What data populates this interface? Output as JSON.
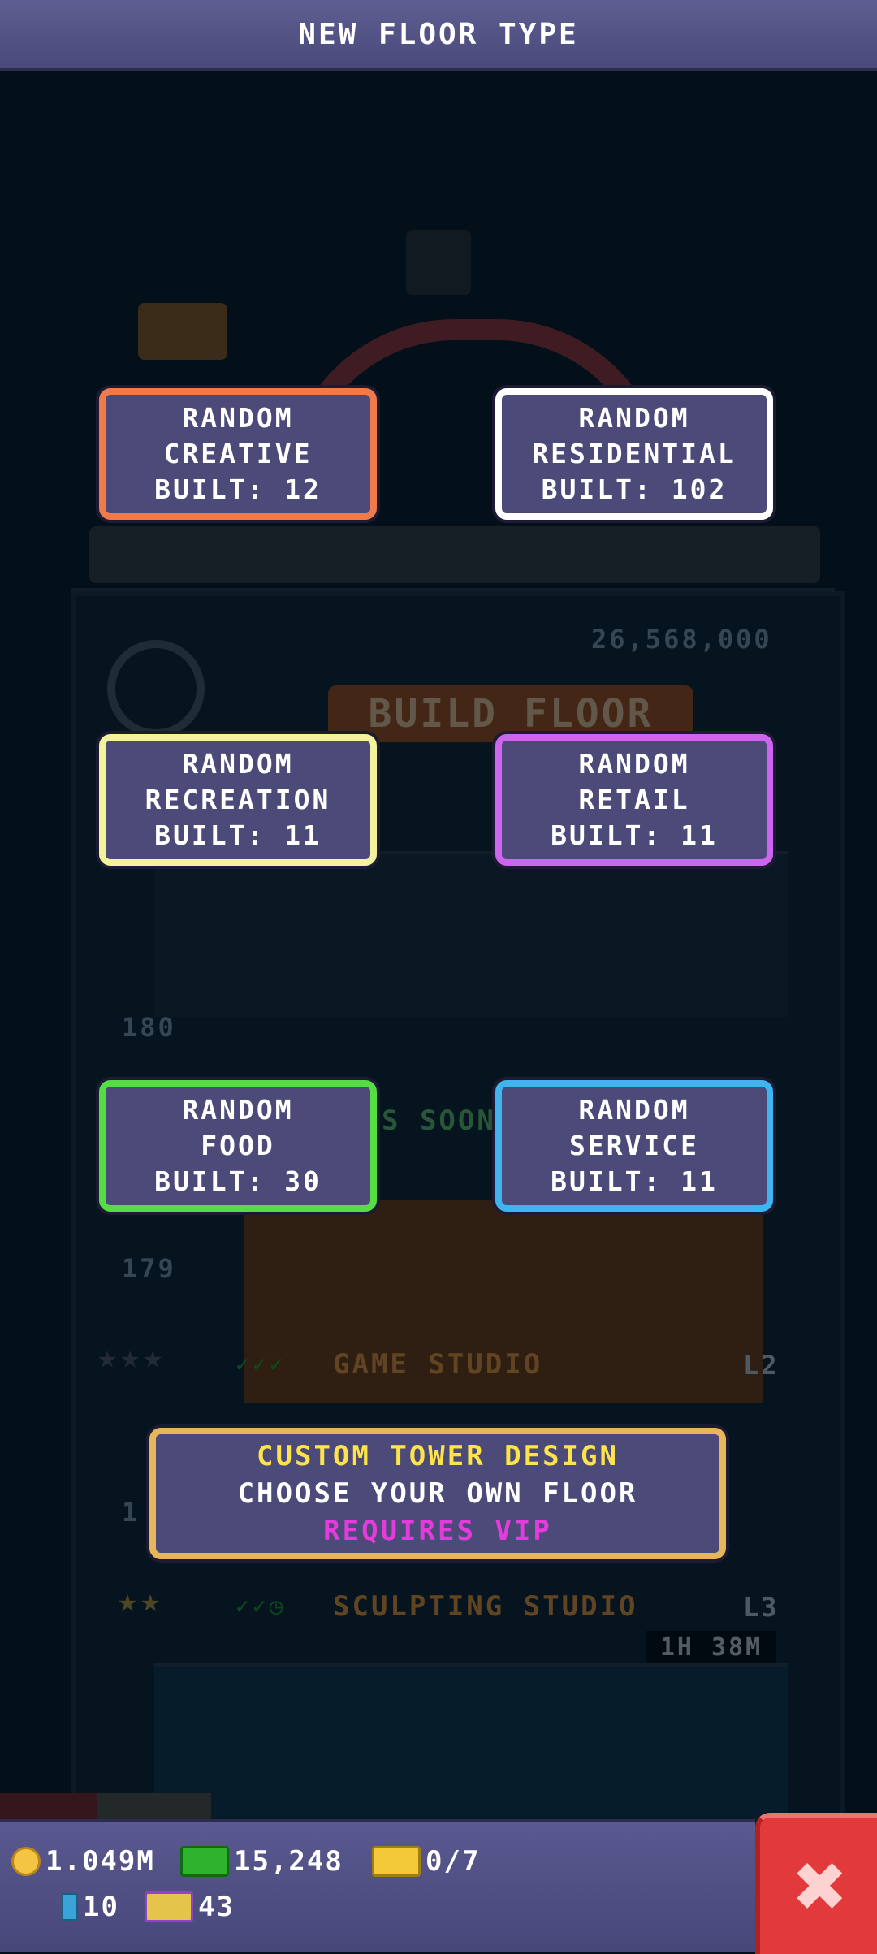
{
  "header": {
    "title": "NEW FLOOR TYPE"
  },
  "floor_types": [
    {
      "line1": "RANDOM",
      "line2": "CREATIVE",
      "line3": "BUILT: 12",
      "color": "#f07a4a"
    },
    {
      "line1": "RANDOM",
      "line2": "RESIDENTIAL",
      "line3": "BUILT: 102",
      "color": "#ffffff"
    },
    {
      "line1": "RANDOM",
      "line2": "RECREATION",
      "line3": "BUILT: 11",
      "color": "#f4f29a"
    },
    {
      "line1": "RANDOM",
      "line2": "RETAIL",
      "line3": "BUILT: 11",
      "color": "#cc66ee"
    },
    {
      "line1": "RANDOM",
      "line2": "FOOD",
      "line3": "BUILT: 30",
      "color": "#55dd44"
    },
    {
      "line1": "RANDOM",
      "line2": "SERVICE",
      "line3": "BUILT: 11",
      "color": "#3fb4ee"
    }
  ],
  "custom": {
    "title": "CUSTOM TOWER DESIGN",
    "subtitle": "CHOOSE YOUR OWN FLOOR",
    "requirement": "REQUIRES VIP",
    "title_color": "#ffe34a",
    "requirement_color": "#e63bdc"
  },
  "background": {
    "build_sign": "BUILD FLOOR",
    "floor_cost": "26,568,000",
    "floor_180": "180",
    "floor_179": "179",
    "coming_soon": "S SOON",
    "floor_1_label": "GAME STUDIO",
    "floor_1_level": "L2",
    "floor_2_label": "SCULPTING STUDIO",
    "floor_2_level": "L3",
    "floor_2_timer": "1H 38M",
    "partial_num": "1"
  },
  "status": {
    "coins": "1.049M",
    "bux": "15,248",
    "tickets": "0/7",
    "bitbook": "10",
    "vip_count": "43"
  },
  "icons": {
    "coins": "coin-icon",
    "bux": "tower-bux-icon",
    "tickets": "ticket-icon",
    "bitbook": "bitcard-icon",
    "vip": "vip-icon",
    "close": "close-icon"
  }
}
